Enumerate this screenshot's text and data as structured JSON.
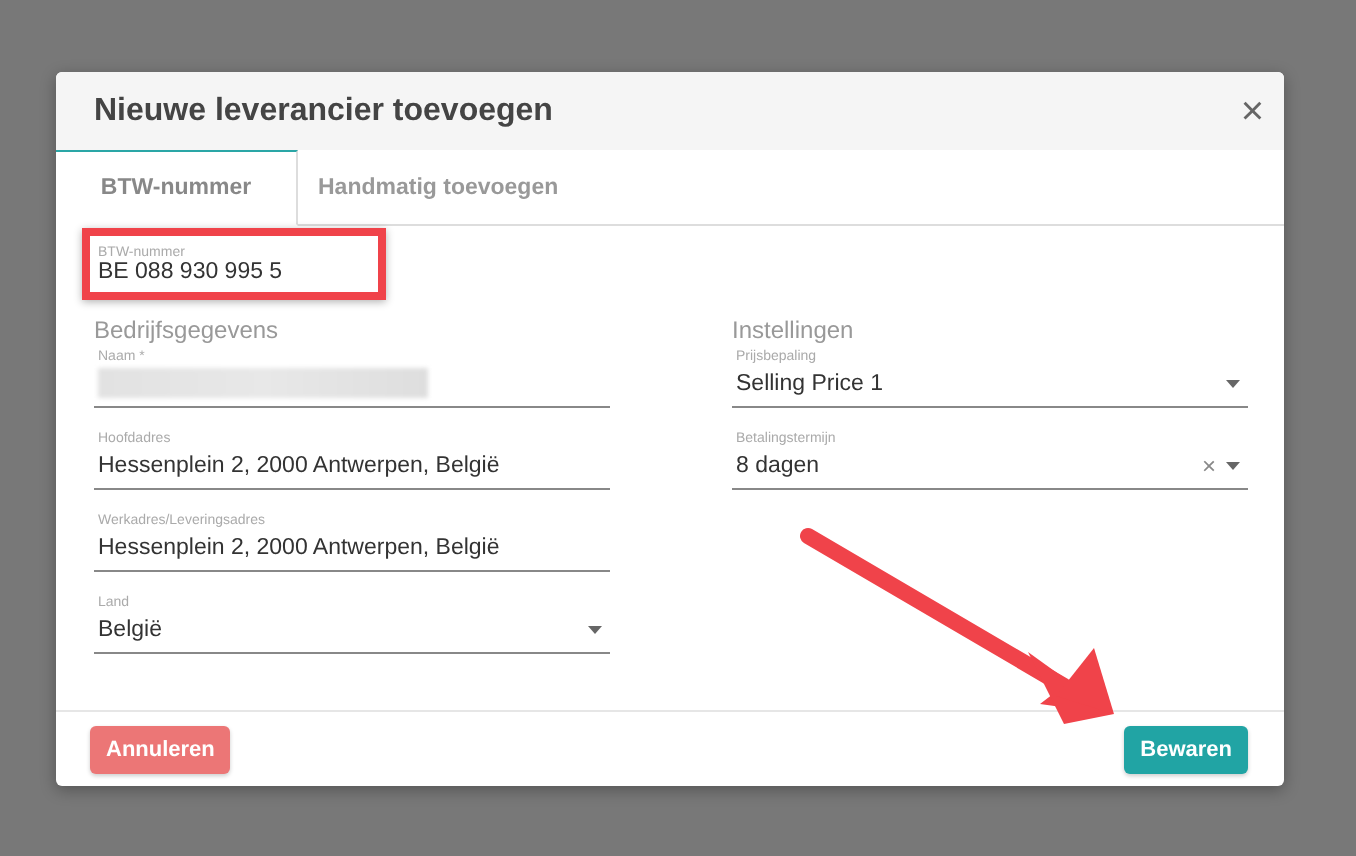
{
  "dialog": {
    "title": "Nieuwe leverancier toevoegen",
    "close": "×"
  },
  "tabs": [
    {
      "label": "BTW-nummer",
      "selected": true
    },
    {
      "label": "Handmatig toevoegen",
      "selected": false
    }
  ],
  "vat_field": {
    "label": "BTW-nummer",
    "value": "BE 088 930 995 5",
    "highlighted": true
  },
  "sections": [
    {
      "heading": "Bedrijfsgegevens",
      "fields": [
        {
          "kind": "redacted",
          "label": "Naam *"
        },
        {
          "kind": "text",
          "label": "Hoofdadres",
          "value": "Hessenplein 2, 2000 Antwerpen, België"
        },
        {
          "kind": "text",
          "label": "Werkadres/Leveringsadres",
          "value": "Hessenplein 2, 2000 Antwerpen, België"
        },
        {
          "kind": "select",
          "label": "Land",
          "value": "België"
        }
      ]
    },
    {
      "heading": "Instellingen",
      "fields": [
        {
          "kind": "select",
          "label": "Prijsbepaling",
          "value": "Selling Price 1"
        },
        {
          "kind": "select",
          "label": "Betalingstermijn",
          "value": "8 dagen",
          "clear": "×"
        }
      ]
    }
  ],
  "buttons": [
    {
      "kind": "cancel",
      "label": "Annuleren"
    },
    {
      "kind": "save",
      "label": "Bewaren"
    }
  ]
}
